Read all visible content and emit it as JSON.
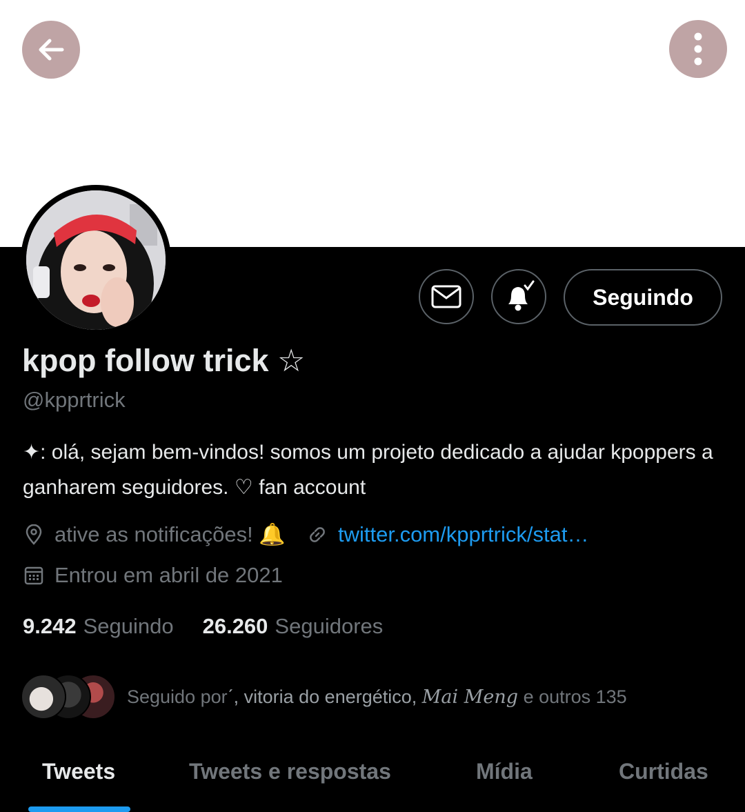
{
  "header": {
    "back_icon": "arrow-left-icon",
    "more_icon": "more-vertical-icon"
  },
  "profile": {
    "display_name": "kpop follow trick ☆",
    "handle": "@kpprtrick",
    "bio": "✦: olá, sejam bem-vindos! somos um projeto dedicado a ajudar kpoppers a ganharem seguidores. ♡ fan account",
    "location": "ative as notificações! 🔔",
    "link": "twitter.com/kpprtrick/stat…",
    "joined": "Entrou em abril de 2021"
  },
  "actions": {
    "message_icon": "mail-icon",
    "notify_icon": "bell-check-icon",
    "follow_label": "Seguindo"
  },
  "stats": {
    "following_count": "9.242",
    "following_label": "Seguindo",
    "followers_count": "26.260",
    "followers_label": "Seguidores"
  },
  "followed_by": {
    "prefix": "Seguido por",
    "name1": "ˊ, vitoria do energético,",
    "name2": "Mai Meng",
    "suffix": "e outros 135"
  },
  "tabs": [
    {
      "label": "Tweets",
      "active": true
    },
    {
      "label": "Tweets e respostas",
      "active": false
    },
    {
      "label": "Mídia",
      "active": false
    },
    {
      "label": "Curtidas",
      "active": false
    }
  ],
  "colors": {
    "accent": "#1d9bf0",
    "background": "#000000",
    "banner": "#ffffff",
    "header_buttons": "#bfa4a5"
  }
}
